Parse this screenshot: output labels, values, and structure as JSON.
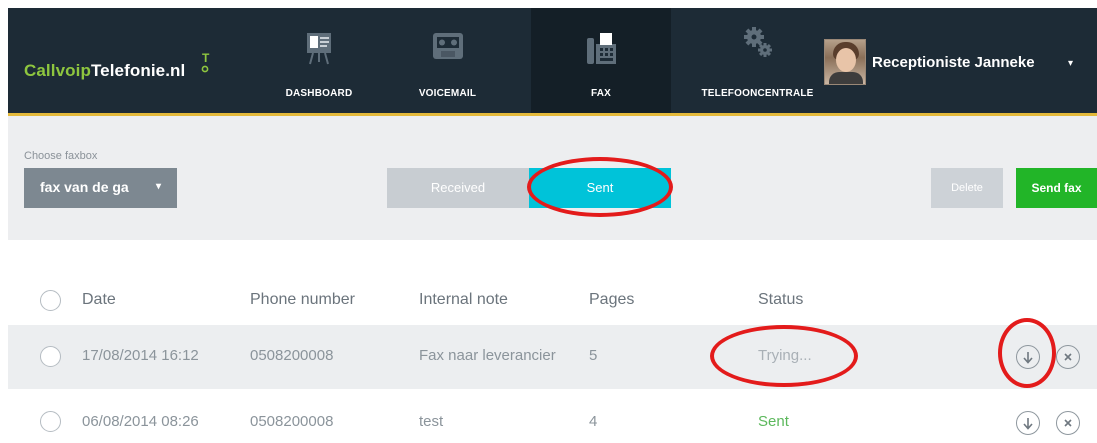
{
  "brand": {
    "part1": "Callvoip",
    "part2": "Telefonie.nl",
    "mark": "T"
  },
  "nav": [
    {
      "label": "DASHBOARD",
      "icon": "presentation-board-icon"
    },
    {
      "label": "VOICEMAIL",
      "icon": "cassette-tape-icon"
    },
    {
      "label": "FAX",
      "icon": "fax-machine-icon",
      "active": true
    },
    {
      "label": "TELEFOONCENTRALE",
      "icon": "gears-icon"
    }
  ],
  "user": {
    "name": "Receptioniste Janneke",
    "caret": "▾"
  },
  "toolbar": {
    "choose_label": "Choose faxbox",
    "faxbox_value": "fax van de ga",
    "tabs": {
      "received": "Received",
      "sent": "Sent"
    },
    "delete_label": "Delete",
    "send_label": "Send fax"
  },
  "table": {
    "headers": {
      "date": "Date",
      "phone": "Phone number",
      "note": "Internal note",
      "pages": "Pages",
      "status": "Status"
    },
    "rows": [
      {
        "date": "17/08/2014 16:12",
        "phone": "0508200008",
        "note": "Fax naar leverancier",
        "pages": "5",
        "status": "Trying..."
      },
      {
        "date": "06/08/2014 08:26",
        "phone": "0508200008",
        "note": "test",
        "pages": "4",
        "status": "Sent"
      }
    ]
  },
  "colors": {
    "topbar": "#1d2b36",
    "accent_line": "#e4b93a",
    "brand_green": "#8ec63f",
    "tab_active": "#00c3d9",
    "send_button": "#22b528",
    "status_sent": "#5cb85c",
    "annotation": "#e31b1b"
  }
}
